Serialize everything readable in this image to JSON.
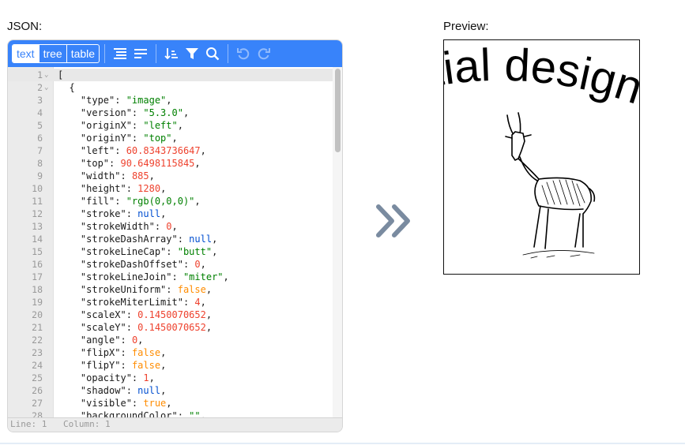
{
  "labels": {
    "json": "JSON:",
    "preview": "Preview:"
  },
  "toolbar": {
    "modes": [
      {
        "label": "text",
        "active": true
      },
      {
        "label": "tree",
        "active": false
      },
      {
        "label": "table",
        "active": false
      }
    ],
    "icons": [
      "format-icon",
      "compact-icon",
      "sort-icon",
      "filter-icon",
      "search-icon",
      "undo-icon",
      "redo-icon"
    ]
  },
  "editor": {
    "lines": [
      {
        "n": "1",
        "fold": "⌄",
        "t": [
          [
            "p",
            "["
          ]
        ]
      },
      {
        "n": "2",
        "fold": "⌄",
        "t": [
          [
            "p",
            "  {"
          ]
        ]
      },
      {
        "n": "3",
        "t": [
          [
            "k",
            "    \"type\""
          ],
          [
            "p",
            ": "
          ],
          [
            "s",
            "\"image\""
          ],
          [
            "p",
            ","
          ]
        ]
      },
      {
        "n": "4",
        "t": [
          [
            "k",
            "    \"version\""
          ],
          [
            "p",
            ": "
          ],
          [
            "s",
            "\"5.3.0\""
          ],
          [
            "p",
            ","
          ]
        ]
      },
      {
        "n": "5",
        "t": [
          [
            "k",
            "    \"originX\""
          ],
          [
            "p",
            ": "
          ],
          [
            "s",
            "\"left\""
          ],
          [
            "p",
            ","
          ]
        ]
      },
      {
        "n": "6",
        "t": [
          [
            "k",
            "    \"originY\""
          ],
          [
            "p",
            ": "
          ],
          [
            "s",
            "\"top\""
          ],
          [
            "p",
            ","
          ]
        ]
      },
      {
        "n": "7",
        "t": [
          [
            "k",
            "    \"left\""
          ],
          [
            "p",
            ": "
          ],
          [
            "n",
            "60.8343736647"
          ],
          [
            "p",
            ","
          ]
        ]
      },
      {
        "n": "8",
        "t": [
          [
            "k",
            "    \"top\""
          ],
          [
            "p",
            ": "
          ],
          [
            "n",
            "90.6498115845"
          ],
          [
            "p",
            ","
          ]
        ]
      },
      {
        "n": "9",
        "t": [
          [
            "k",
            "    \"width\""
          ],
          [
            "p",
            ": "
          ],
          [
            "n",
            "885"
          ],
          [
            "p",
            ","
          ]
        ]
      },
      {
        "n": "10",
        "t": [
          [
            "k",
            "    \"height\""
          ],
          [
            "p",
            ": "
          ],
          [
            "n",
            "1280"
          ],
          [
            "p",
            ","
          ]
        ]
      },
      {
        "n": "11",
        "t": [
          [
            "k",
            "    \"fill\""
          ],
          [
            "p",
            ": "
          ],
          [
            "s",
            "\"rgb(0,0,0)\""
          ],
          [
            "p",
            ","
          ]
        ]
      },
      {
        "n": "12",
        "t": [
          [
            "k",
            "    \"stroke\""
          ],
          [
            "p",
            ": "
          ],
          [
            "nl",
            "null"
          ],
          [
            "p",
            ","
          ]
        ]
      },
      {
        "n": "13",
        "t": [
          [
            "k",
            "    \"strokeWidth\""
          ],
          [
            "p",
            ": "
          ],
          [
            "n",
            "0"
          ],
          [
            "p",
            ","
          ]
        ]
      },
      {
        "n": "14",
        "t": [
          [
            "k",
            "    \"strokeDashArray\""
          ],
          [
            "p",
            ": "
          ],
          [
            "nl",
            "null"
          ],
          [
            "p",
            ","
          ]
        ]
      },
      {
        "n": "15",
        "t": [
          [
            "k",
            "    \"strokeLineCap\""
          ],
          [
            "p",
            ": "
          ],
          [
            "s",
            "\"butt\""
          ],
          [
            "p",
            ","
          ]
        ]
      },
      {
        "n": "16",
        "t": [
          [
            "k",
            "    \"strokeDashOffset\""
          ],
          [
            "p",
            ": "
          ],
          [
            "n",
            "0"
          ],
          [
            "p",
            ","
          ]
        ]
      },
      {
        "n": "17",
        "t": [
          [
            "k",
            "    \"strokeLineJoin\""
          ],
          [
            "p",
            ": "
          ],
          [
            "s",
            "\"miter\""
          ],
          [
            "p",
            ","
          ]
        ]
      },
      {
        "n": "18",
        "t": [
          [
            "k",
            "    \"strokeUniform\""
          ],
          [
            "p",
            ": "
          ],
          [
            "b",
            "false"
          ],
          [
            "p",
            ","
          ]
        ]
      },
      {
        "n": "19",
        "t": [
          [
            "k",
            "    \"strokeMiterLimit\""
          ],
          [
            "p",
            ": "
          ],
          [
            "n",
            "4"
          ],
          [
            "p",
            ","
          ]
        ]
      },
      {
        "n": "20",
        "t": [
          [
            "k",
            "    \"scaleX\""
          ],
          [
            "p",
            ": "
          ],
          [
            "n",
            "0.1450070652"
          ],
          [
            "p",
            ","
          ]
        ]
      },
      {
        "n": "21",
        "t": [
          [
            "k",
            "    \"scaleY\""
          ],
          [
            "p",
            ": "
          ],
          [
            "n",
            "0.1450070652"
          ],
          [
            "p",
            ","
          ]
        ]
      },
      {
        "n": "22",
        "t": [
          [
            "k",
            "    \"angle\""
          ],
          [
            "p",
            ": "
          ],
          [
            "n",
            "0"
          ],
          [
            "p",
            ","
          ]
        ]
      },
      {
        "n": "23",
        "t": [
          [
            "k",
            "    \"flipX\""
          ],
          [
            "p",
            ": "
          ],
          [
            "b",
            "false"
          ],
          [
            "p",
            ","
          ]
        ]
      },
      {
        "n": "24",
        "t": [
          [
            "k",
            "    \"flipY\""
          ],
          [
            "p",
            ": "
          ],
          [
            "b",
            "false"
          ],
          [
            "p",
            ","
          ]
        ]
      },
      {
        "n": "25",
        "t": [
          [
            "k",
            "    \"opacity\""
          ],
          [
            "p",
            ": "
          ],
          [
            "n",
            "1"
          ],
          [
            "p",
            ","
          ]
        ]
      },
      {
        "n": "26",
        "t": [
          [
            "k",
            "    \"shadow\""
          ],
          [
            "p",
            ": "
          ],
          [
            "nl",
            "null"
          ],
          [
            "p",
            ","
          ]
        ]
      },
      {
        "n": "27",
        "t": [
          [
            "k",
            "    \"visible\""
          ],
          [
            "p",
            ": "
          ],
          [
            "b",
            "true"
          ],
          [
            "p",
            ","
          ]
        ]
      },
      {
        "n": "28",
        "t": [
          [
            "k",
            "    \"backgroundColor\""
          ],
          [
            "p",
            ": "
          ],
          [
            "s",
            "\"\""
          ],
          [
            "p",
            ","
          ]
        ]
      }
    ]
  },
  "status": {
    "line": "Line: 1",
    "column": "Column: 1"
  },
  "preview": {
    "curved_text": "initial design"
  },
  "colors": {
    "toolbar": "#3883fa",
    "key": "#1a1a1a",
    "string": "#008000",
    "number": "#ee422e",
    "boolean": "#ff8c00",
    "null": "#004ed0",
    "arrow": "#7a8ba0"
  }
}
